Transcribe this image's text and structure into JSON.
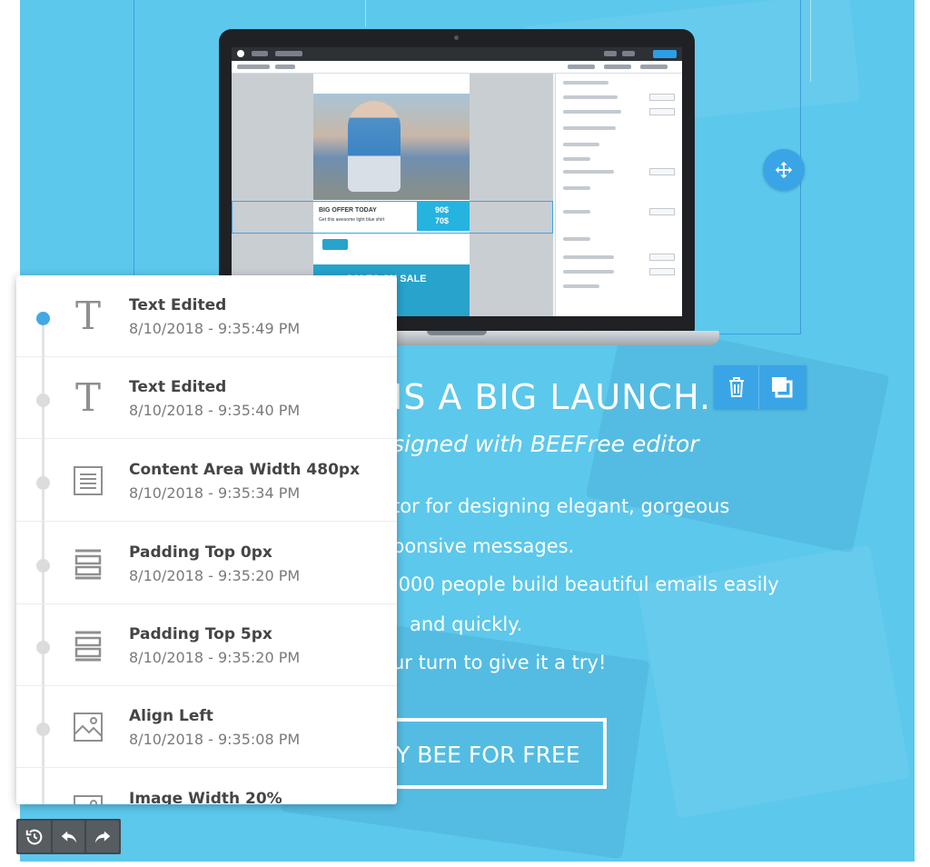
{
  "hero": {
    "title": "IS A BIG LAUNCH.",
    "subtitle": "signed with BEEFree editor",
    "body_lines": [
      "tor for designing elegant,  gorgeous",
      "ponsive messages.",
      ",000 people build beautiful emails easily",
      "and quickly.",
      "ur turn to give it a try!"
    ],
    "cta_label": "Y BEE FOR FREE"
  },
  "laptop_screen": {
    "offer_title": "BIG OFFER TODAY",
    "offer_sub": "Get this awesome light blue shirt",
    "price_old": "90$",
    "price_new": "70$",
    "sale_text": "SALES ON SALE"
  },
  "history": {
    "items": [
      {
        "label": "Text Edited",
        "time": "8/10/2018 - 9:35:49 PM",
        "icon": "text-icon",
        "active": true
      },
      {
        "label": "Text Edited",
        "time": "8/10/2018 - 9:35:40 PM",
        "icon": "text-icon",
        "active": false
      },
      {
        "label": "Content Area Width 480px",
        "time": "8/10/2018 - 9:35:34 PM",
        "icon": "content-area-icon",
        "active": false
      },
      {
        "label": "Padding Top 0px",
        "time": "8/10/2018 - 9:35:20 PM",
        "icon": "padding-icon",
        "active": false
      },
      {
        "label": "Padding Top 5px",
        "time": "8/10/2018 - 9:35:20 PM",
        "icon": "padding-icon",
        "active": false
      },
      {
        "label": "Align Left",
        "time": "8/10/2018 - 9:35:08 PM",
        "icon": "image-icon",
        "active": false
      },
      {
        "label": "Image Width 20%",
        "time": "",
        "icon": "image-icon",
        "active": false
      }
    ]
  },
  "toolbar": {
    "icons": [
      "history-icon",
      "undo-icon",
      "redo-icon"
    ]
  },
  "colors": {
    "hero_bg": "#5cc8ec",
    "accent": "#42a9e5",
    "panel_bg": "#ffffff",
    "toolbar_bg": "#42474c"
  }
}
